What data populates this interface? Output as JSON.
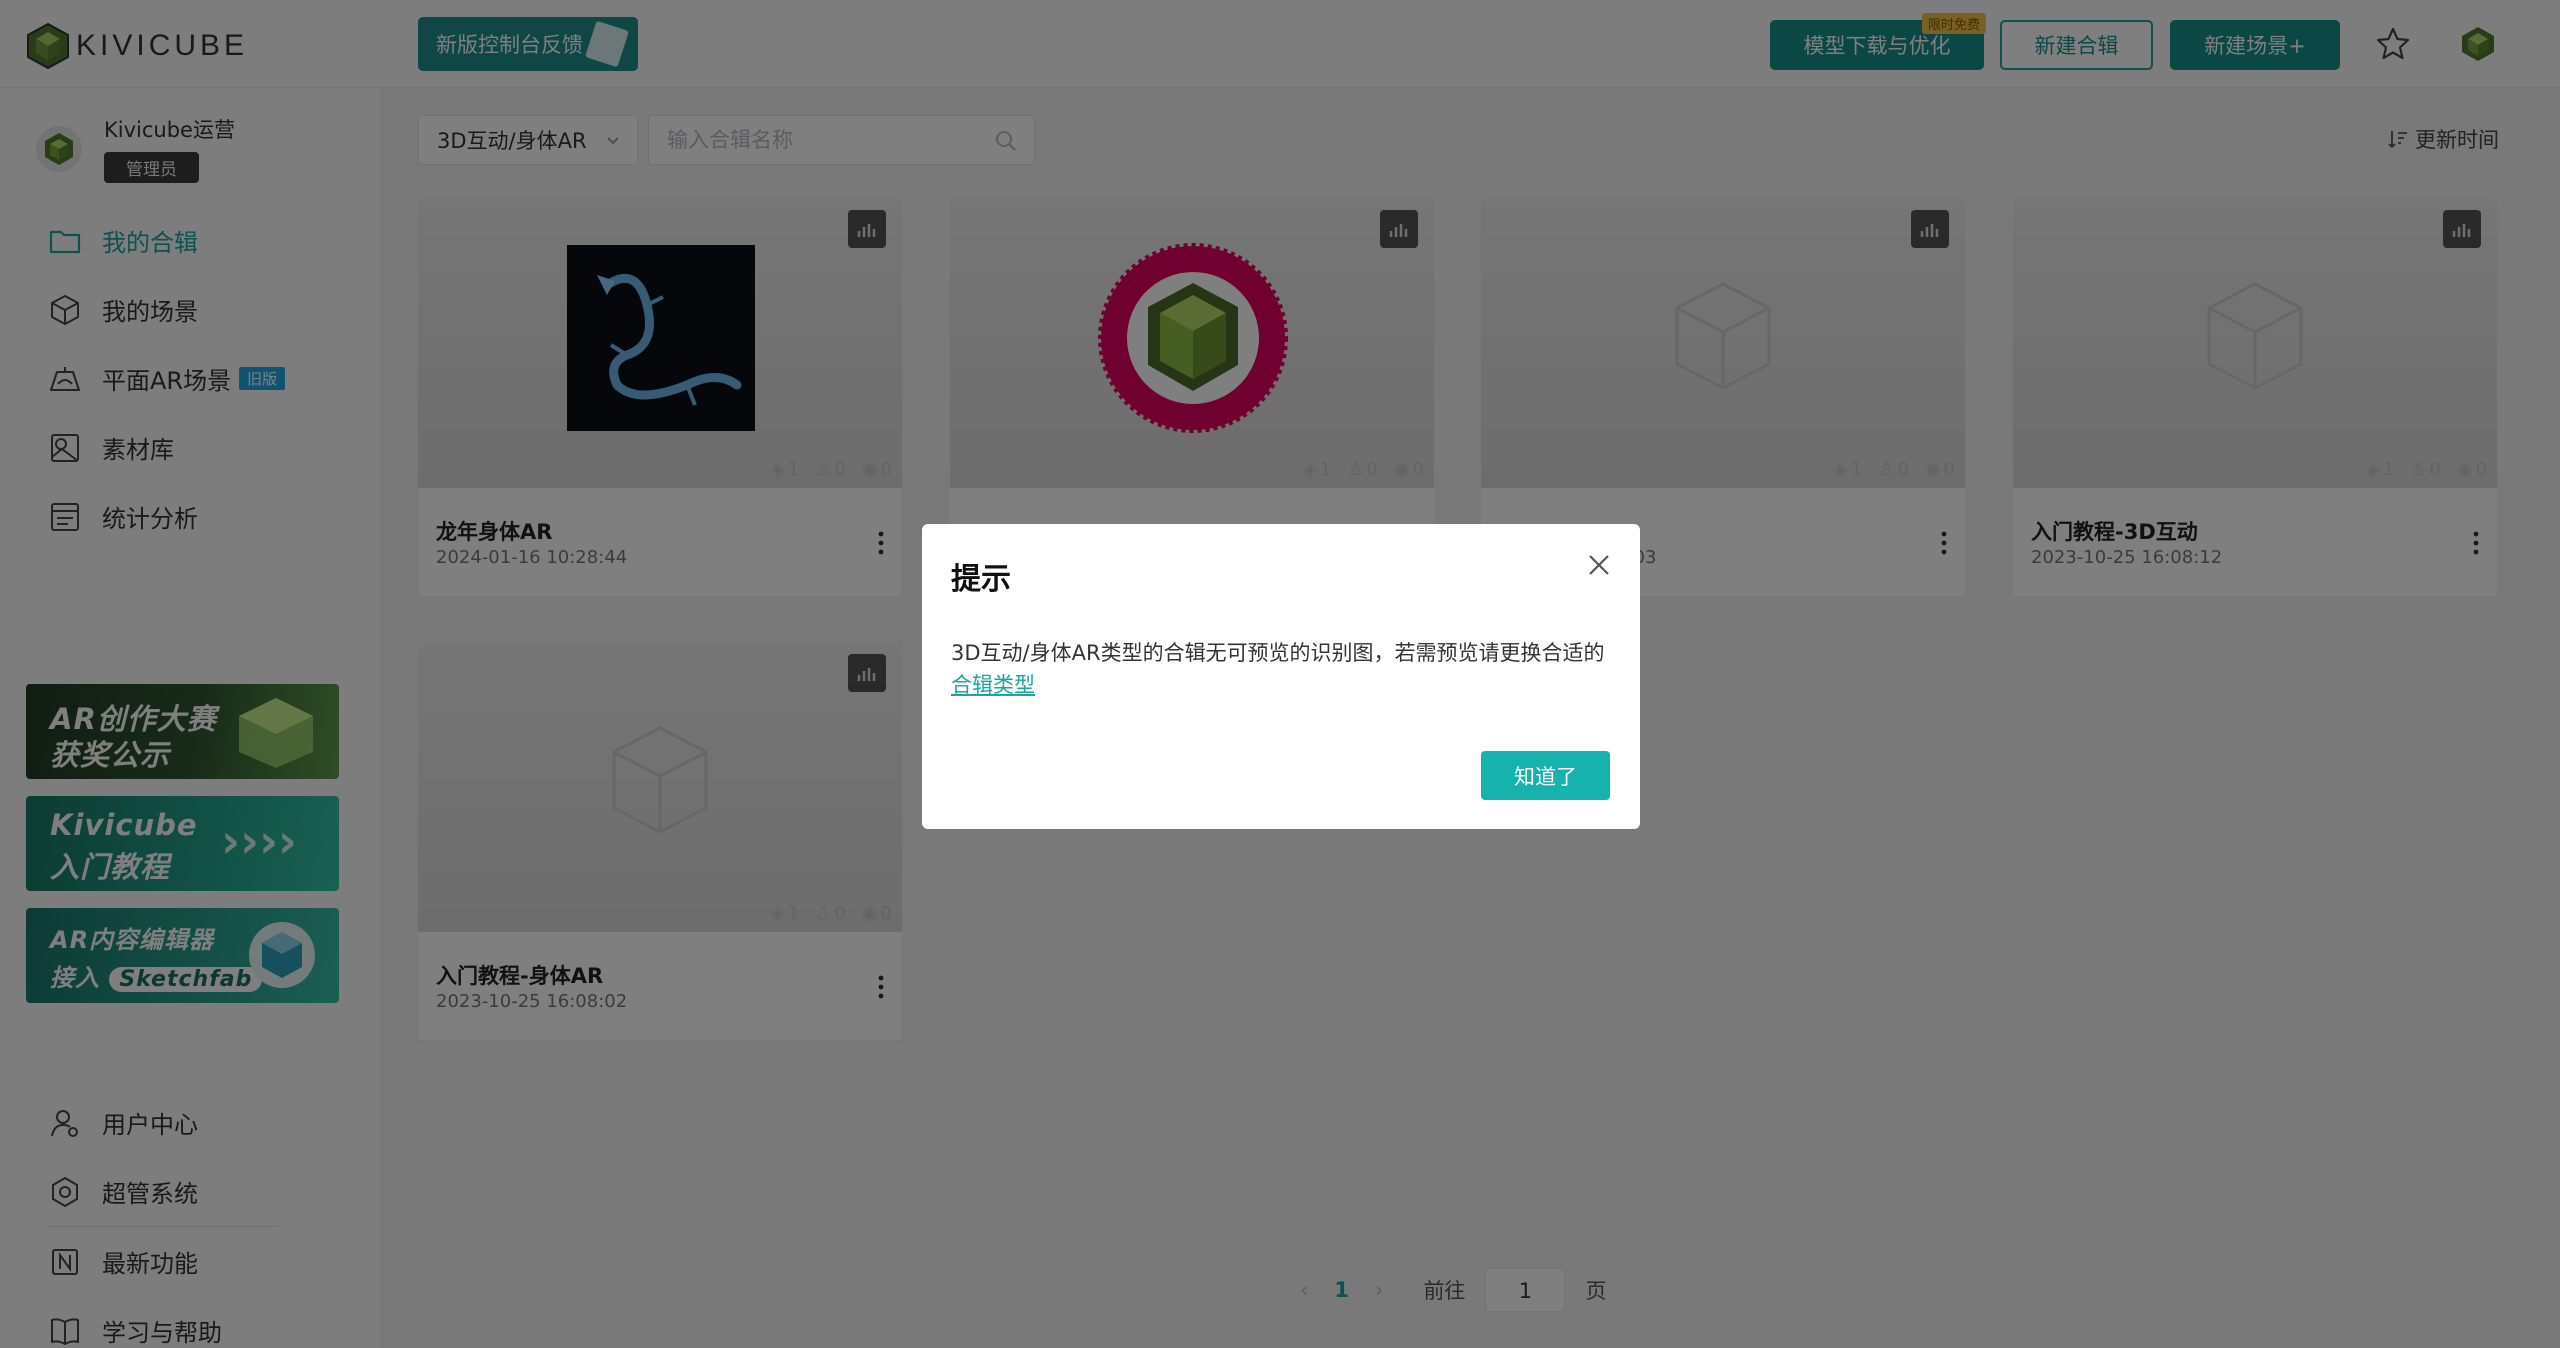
{
  "header": {
    "logo_text": "KIVICUBE",
    "feedback_label": "新版控制台反馈",
    "model_download_label": "模型下载与优化",
    "model_badge": "限时免费",
    "new_collection_label": "新建合辑",
    "new_scene_label": "新建场景+"
  },
  "sidebar": {
    "user_name": "Kivicube运营",
    "user_role": "管理员",
    "nav": [
      {
        "label": "我的合辑",
        "icon": "folder-icon",
        "active": true
      },
      {
        "label": "我的场景",
        "icon": "cube-icon"
      },
      {
        "label": "平面AR场景",
        "icon": "ar-plane-icon",
        "tag": "旧版"
      },
      {
        "label": "素材库",
        "icon": "material-library-icon"
      },
      {
        "label": "统计分析",
        "icon": "statistics-icon"
      }
    ],
    "banners": [
      {
        "line1": "AR创作大赛",
        "line2": "获奖公示"
      },
      {
        "line1": "Kivicube",
        "line2": "入门教程",
        "arrows": "››››"
      },
      {
        "line1": "AR内容编辑器",
        "line2": "接入",
        "pill": "Sketchfab"
      }
    ],
    "nav_bottom": [
      {
        "label": "用户中心",
        "icon": "user-center-icon"
      },
      {
        "label": "超管系统",
        "icon": "settings-icon"
      },
      {
        "label": "最新功能",
        "icon": "new-feature-icon"
      },
      {
        "label": "学习与帮助",
        "icon": "book-icon"
      }
    ]
  },
  "filters": {
    "collection_type": "3D互动/身体AR",
    "search_placeholder": "输入合辑名称",
    "sort_label": "更新时间"
  },
  "cards": [
    {
      "title": "龙年身体AR",
      "date": "2024-01-16 10:28:44",
      "layers": "1",
      "users": "0",
      "views": "0",
      "thumb": "dragon"
    },
    {
      "title": "",
      "date": "",
      "layers": "1",
      "users": "0",
      "views": "0",
      "thumb": "kivi-badge"
    },
    {
      "title": "",
      "date": "2:03",
      "layers": "1",
      "users": "0",
      "views": "0",
      "thumb": "placeholder"
    },
    {
      "title": "入门教程-3D互动",
      "date": "2023-10-25 16:08:12",
      "layers": "1",
      "users": "0",
      "views": "0",
      "thumb": "placeholder"
    },
    {
      "title": "入门教程-身体AR",
      "date": "2023-10-25 16:08:02",
      "layers": "1",
      "users": "0",
      "views": "0",
      "thumb": "placeholder"
    }
  ],
  "pagination": {
    "prev": "‹",
    "current": "1",
    "next": "›",
    "goto_label": "前往",
    "goto_value": "1",
    "page_suffix": "页"
  },
  "dialog": {
    "title": "提示",
    "message": "3D互动/身体AR类型的合辑无可预览的识别图，若需预览请更换合适的",
    "link": "合辑类型",
    "confirm": "知道了"
  },
  "colors": {
    "brand": "#16b2ad",
    "brand_dark": "#158f8b"
  }
}
